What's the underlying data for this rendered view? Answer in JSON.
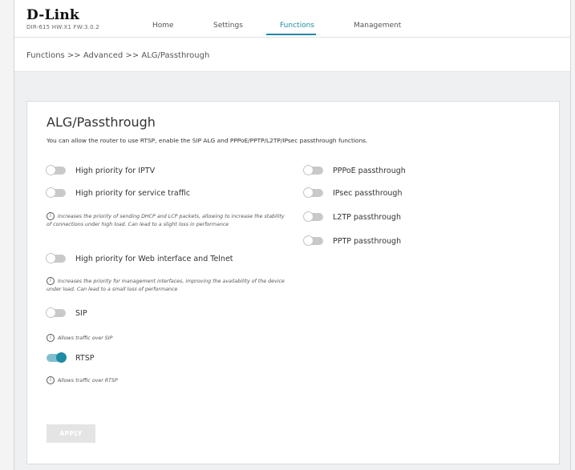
{
  "header": {
    "logo": "D-Link",
    "firmware": "DIR-615 HW:X1 FW:3.0.2",
    "nav": [
      {
        "label": "Home"
      },
      {
        "label": "Settings"
      },
      {
        "label": "Functions"
      },
      {
        "label": "Management"
      }
    ],
    "active_nav": "Functions"
  },
  "breadcrumb": "Functions >> Advanced >> ALG/Passthrough",
  "page": {
    "title": "ALG/Passthrough",
    "description": "You can allow the router to use RTSP, enable the SIP ALG and PPPoE/PPTP/L2TP/IPsec passthrough functions.",
    "left": [
      {
        "label": "High priority for IPTV",
        "enabled": false
      },
      {
        "label": "High priority for service traffic",
        "enabled": false,
        "note": "Increases the priority of sending DHCP and LCP packets, allowing to increase the stability of connections under high load. Can lead to a slight loss in performance"
      },
      {
        "label": "High priority for Web interface and Telnet",
        "enabled": false,
        "note": "Increases the priority for management interfaces, improving the availability of the device under load. Can lead to a small loss of performance"
      },
      {
        "label": "SIP",
        "enabled": false,
        "note": "Allows traffic over SIP"
      },
      {
        "label": "RTSP",
        "enabled": true,
        "note": "Allows traffic over RTSP"
      }
    ],
    "right": [
      {
        "label": "PPPoE passthrough",
        "enabled": false
      },
      {
        "label": "IPsec passthrough",
        "enabled": false
      },
      {
        "label": "L2TP passthrough",
        "enabled": false
      },
      {
        "label": "PPTP passthrough",
        "enabled": false
      }
    ],
    "apply_label": "APPLY",
    "info_glyph": "i"
  },
  "colors": {
    "accent": "#1f8ba2",
    "toggle_off": "#c9c9c9",
    "apply_disabled": "#e4e4e4"
  }
}
